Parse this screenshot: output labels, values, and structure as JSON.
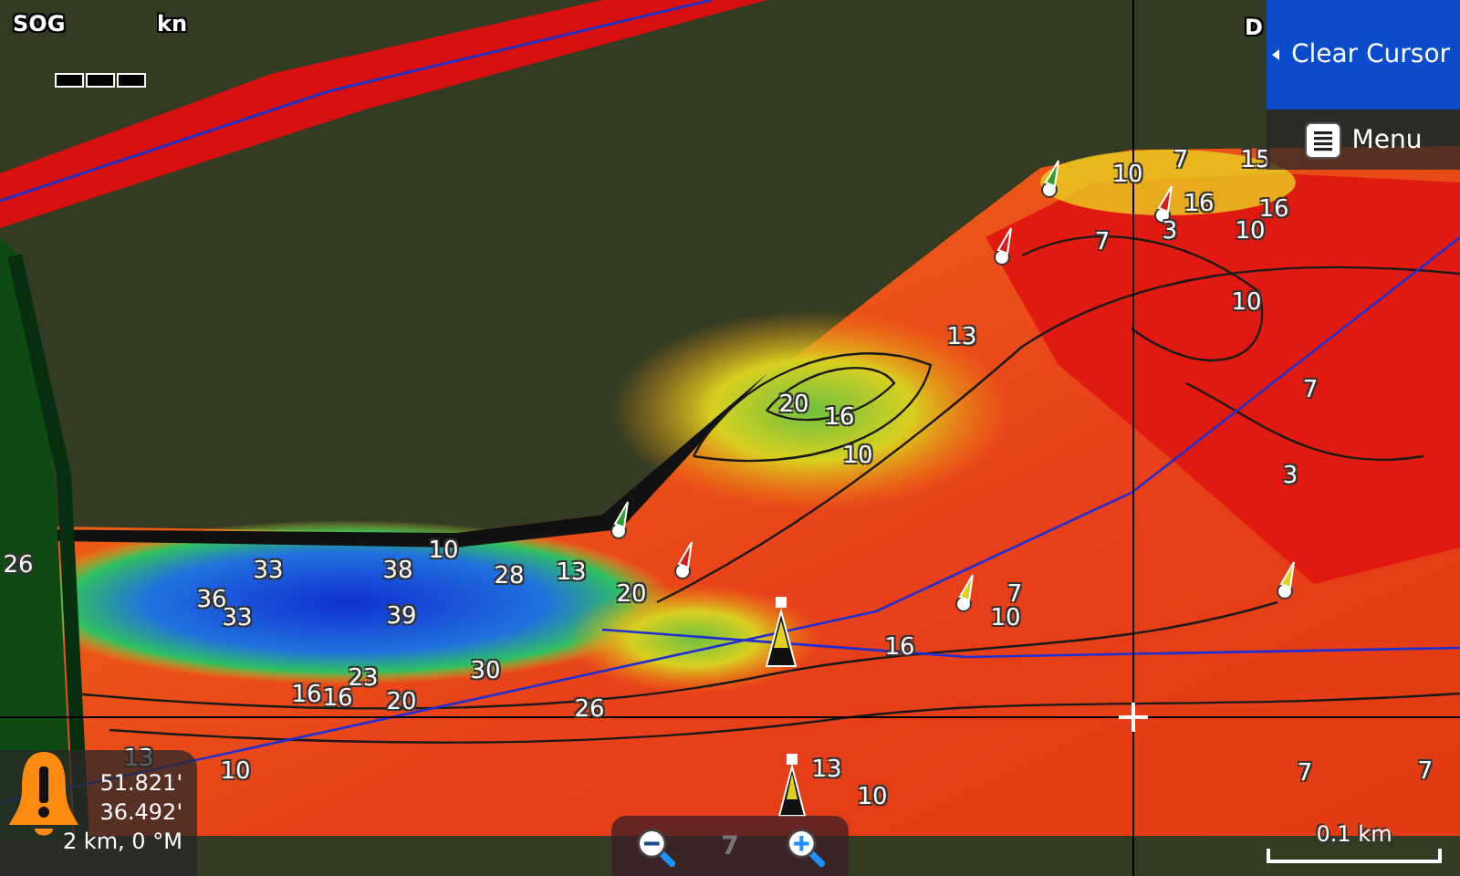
{
  "status": {
    "sog_label": "SOG",
    "sog_unit": "kn",
    "range_label": "D"
  },
  "buttons": [
    {
      "label": "Clear Cursor",
      "kind": "primary"
    },
    {
      "label": "Menu",
      "kind": "menu"
    }
  ],
  "soundings": [
    "10",
    "7",
    "15",
    "16",
    "16",
    "7",
    "3",
    "10",
    "10",
    "13",
    "7",
    "20",
    "16",
    "10",
    "3",
    "10",
    "26",
    "33",
    "38",
    "28",
    "13",
    "36",
    "20",
    "7",
    "33",
    "39",
    "10",
    "16",
    "23",
    "30",
    "16",
    "16",
    "20",
    "26",
    "13",
    "10",
    "13",
    "7",
    "7",
    "10"
  ],
  "cursor_info": {
    "lines": [
      "51.821'",
      "36.492'",
      "2 km, 0 °M"
    ],
    "alarm": true
  },
  "zoom_controls": {
    "faded_sounding": "7"
  },
  "scale_bar": {
    "label": "0.1 km"
  }
}
